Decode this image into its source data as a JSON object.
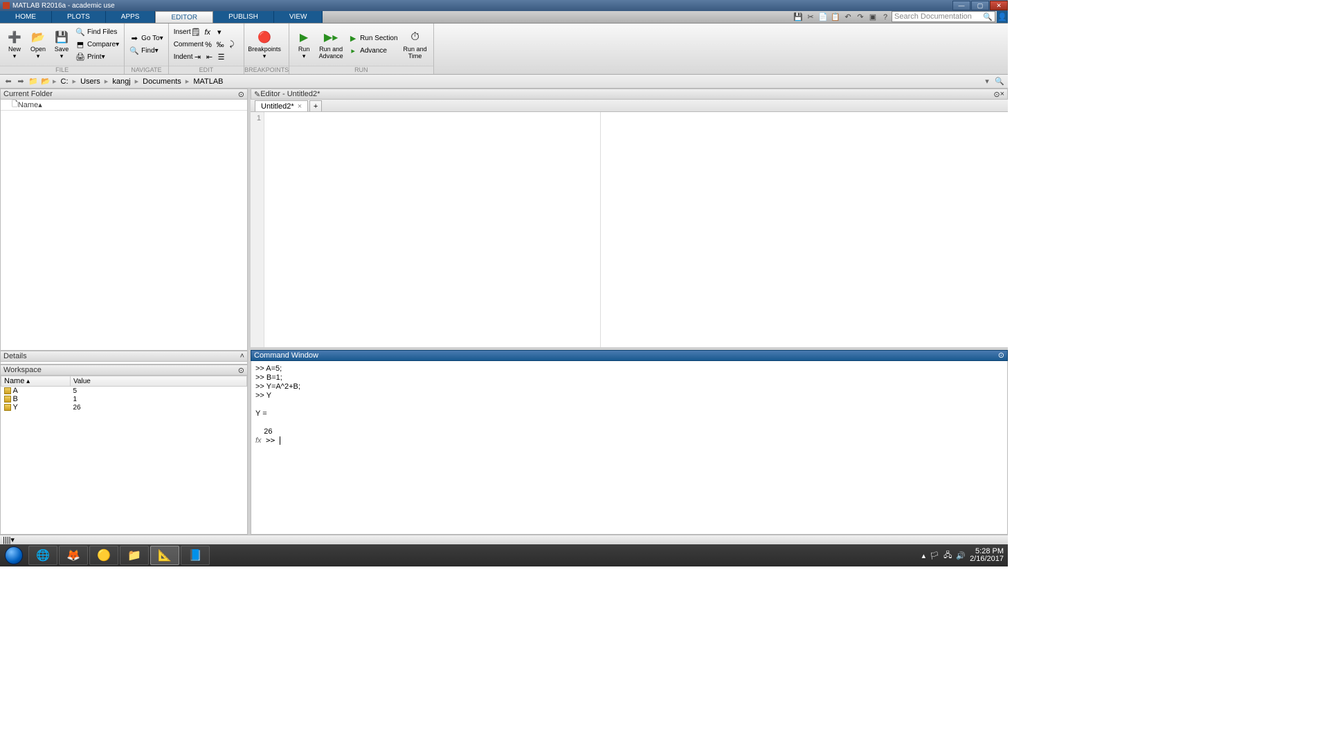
{
  "titlebar": {
    "text": "MATLAB R2016a - academic use"
  },
  "tabs": {
    "items": [
      "HOME",
      "PLOTS",
      "APPS",
      "EDITOR",
      "PUBLISH",
      "VIEW"
    ],
    "active": 3
  },
  "search": {
    "placeholder": "Search Documentation"
  },
  "toolgroups": {
    "file": {
      "label": "FILE",
      "new": "New",
      "open": "Open",
      "save": "Save",
      "find": "Find Files",
      "compare": "Compare",
      "print": "Print"
    },
    "navigate": {
      "label": "NAVIGATE",
      "goto": "Go To",
      "find": "Find"
    },
    "edit": {
      "label": "EDIT",
      "insert": "Insert",
      "comment": "Comment",
      "indent": "Indent"
    },
    "breakpoints": {
      "label": "BREAKPOINTS",
      "btn": "Breakpoints"
    },
    "run": {
      "label": "RUN",
      "run": "Run",
      "runadv": "Run and\nAdvance",
      "runsec": "Run Section",
      "advance": "Advance",
      "runtime": "Run and\nTime"
    }
  },
  "breadcrumbs": [
    "C:",
    "Users",
    "kangj",
    "Documents",
    "MATLAB"
  ],
  "currentFolder": {
    "title": "Current Folder",
    "colName": "Name"
  },
  "details": {
    "title": "Details"
  },
  "workspace": {
    "title": "Workspace",
    "cols": {
      "name": "Name",
      "value": "Value"
    },
    "rows": [
      {
        "name": "A",
        "value": "5"
      },
      {
        "name": "B",
        "value": "1"
      },
      {
        "name": "Y",
        "value": "26"
      }
    ]
  },
  "editor": {
    "title": "Editor - Untitled2*",
    "tab": "Untitled2*",
    "line1": "1"
  },
  "cmdwin": {
    "title": "Command Window",
    "content": ">> A=5;\n>> B=1;\n>> Y=A^2+B;\n>> Y\n\nY =\n\n    26\n"
  },
  "statusbar": {
    "text": "||||▾"
  },
  "systray": {
    "time": "5:28 PM",
    "date": "2/16/2017"
  }
}
